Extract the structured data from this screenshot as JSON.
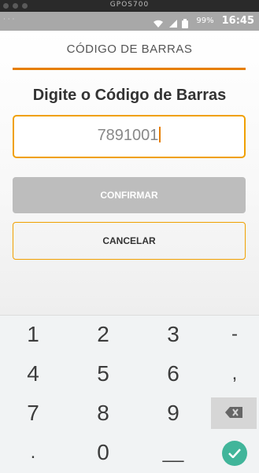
{
  "window": {
    "title": "GPOS700"
  },
  "statusbar": {
    "battery": "99%",
    "time": "16:45",
    "left_dots": "· · ·"
  },
  "app": {
    "title": "CÓDIGO DE BARRAS",
    "prompt": "Digite o Código de Barras",
    "barcode_value": "7891001",
    "confirm_label": "CONFIRMAR",
    "cancel_label": "CANCELAR",
    "accent_color": "#e67e00"
  },
  "keypad": {
    "keys": [
      "1",
      "2",
      "3",
      "-",
      "4",
      "5",
      "6",
      ",",
      "7",
      "8",
      "9",
      ".",
      "0",
      "__"
    ],
    "backspace_icon": "backspace-icon",
    "done_icon": "check-icon",
    "done_color": "#41b59a"
  }
}
